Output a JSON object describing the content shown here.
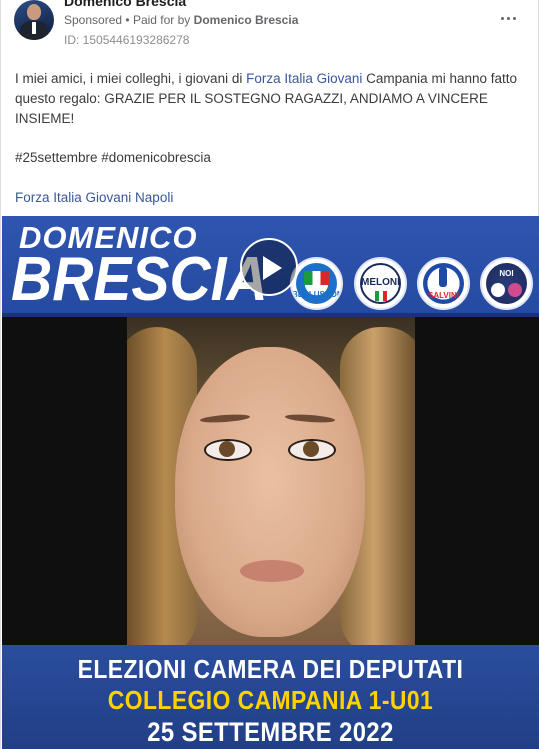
{
  "post": {
    "page_name": "Domenico Brescia",
    "sponsored": "Sponsored",
    "paid_for_prefix": "Paid for by",
    "paid_for": "Domenico Brescia",
    "ad_id": "ID: 1505446193286278",
    "text_before_link": "I miei amici, i miei colleghi, i giovani di ",
    "text_link": "Forza Italia Giovani",
    "text_after_link": " Campania mi hanno fatto questo regalo: GRAZIE PER IL SOSTEGNO RAGAZZI, ANDIAMO A VINCERE INSIEME!",
    "hashtags": "#25settembre #domenicobrescia",
    "page_link": "Forza Italia Giovani Napoli"
  },
  "media": {
    "candidate_first": "DOMENICO",
    "candidate_last": "BRESCIA",
    "logos": [
      {
        "icon": "forza-italia-logo",
        "text": "BERLUSCONI",
        "color": "#1d6fc9"
      },
      {
        "icon": "fratelli-italia-logo",
        "text": "MELONI",
        "color": "#1a2c5e"
      },
      {
        "icon": "lega-logo",
        "text": "SALVINI",
        "color": "#1f4aa8"
      },
      {
        "icon": "noi-moderati-logo",
        "text": "NOI",
        "color": "#2a3c78"
      }
    ],
    "line1": "ELEZIONI CAMERA DEI DEPUTATI",
    "line2": "COLLEGIO CAMPANIA 1-U01",
    "line3": "25 SETTEMBRE 2022"
  },
  "colors": {
    "link": "#385898",
    "banner_blue": "#254aa0",
    "accent_yellow": "#ffd200"
  }
}
